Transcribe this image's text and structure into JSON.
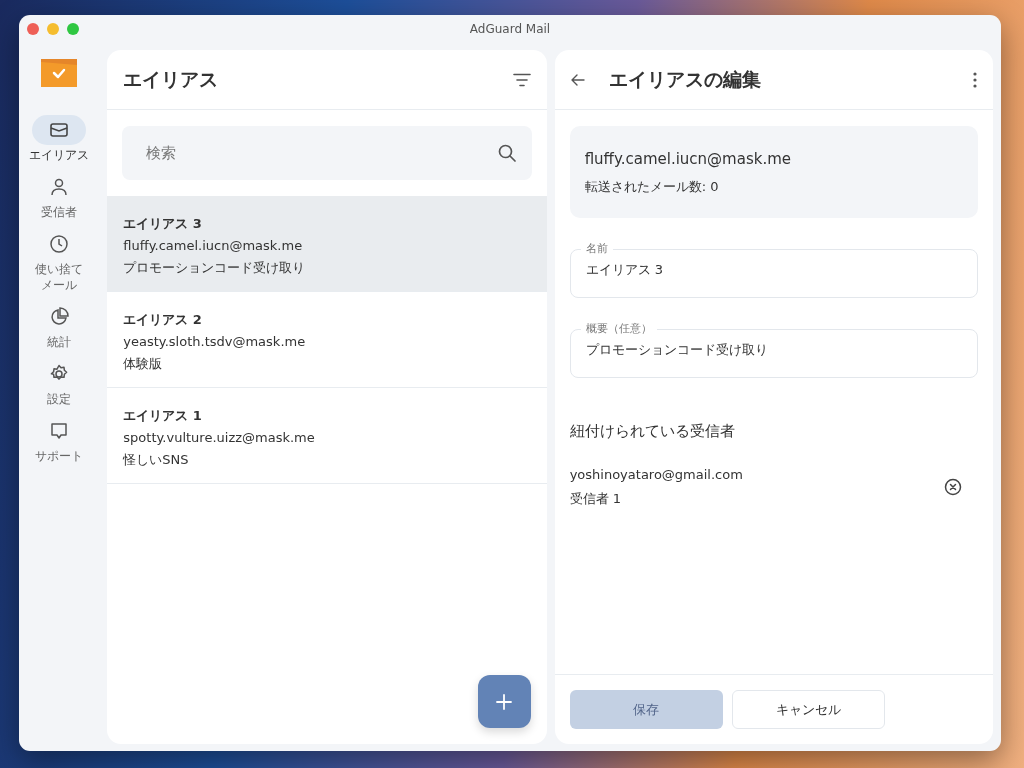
{
  "window": {
    "title": "AdGuard Mail"
  },
  "sidebar": {
    "items": [
      {
        "label_lines": [
          "エイリアス"
        ],
        "selected": true
      },
      {
        "label_lines": [
          "受信者"
        ],
        "selected": false
      },
      {
        "label_lines": [
          "使い捨て",
          "メール"
        ],
        "selected": false
      },
      {
        "label_lines": [
          "統計"
        ],
        "selected": false
      },
      {
        "label_lines": [
          "設定"
        ],
        "selected": false
      },
      {
        "label_lines": [
          "サポート"
        ],
        "selected": false
      }
    ]
  },
  "alias_list": {
    "title": "エイリアス",
    "search": {
      "placeholder": "検索"
    },
    "items": [
      {
        "name": "エイリアス 3",
        "email": "fluffy.camel.iucn@mask.me",
        "description": "プロモーションコード受け取り",
        "selected": true
      },
      {
        "name": "エイリアス 2",
        "email": "yeasty.sloth.tsdv@mask.me",
        "description": "体験版",
        "selected": false
      },
      {
        "name": "エイリアス 1",
        "email": "spotty.vulture.uizz@mask.me",
        "description": "怪しいSNS",
        "selected": false
      }
    ]
  },
  "editor": {
    "title": "エイリアスの編集",
    "email": "fluffy.camel.iucn@mask.me",
    "forwarded": "転送されたメール数: 0",
    "fields": [
      {
        "label": "名前",
        "value": "エイリアス 3"
      },
      {
        "label": "概要（任意）",
        "value": "プロモーションコード受け取り"
      }
    ],
    "recipients_heading": "紐付けられている受信者",
    "recipients": [
      {
        "email": "yoshinoyataro@gmail.com",
        "name": "受信者 1"
      }
    ],
    "buttons": [
      {
        "label": "保存",
        "kind": "primary",
        "disabled": true
      },
      {
        "label": "キャンセル",
        "kind": "secondary"
      }
    ]
  }
}
